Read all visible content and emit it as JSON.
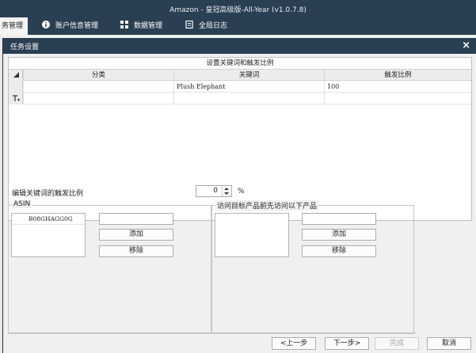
{
  "app": {
    "title": "Amazon - 皇冠高级版-All-Year  (v1.0.7.8)",
    "menu": [
      {
        "label": "务管理",
        "icon": "",
        "active": true
      },
      {
        "label": "账户信息管理",
        "icon": "info-icon",
        "active": false
      },
      {
        "label": "数据管理",
        "icon": "grid-icon",
        "active": false
      },
      {
        "label": "全局日志",
        "icon": "document-icon",
        "active": false
      }
    ]
  },
  "dialog": {
    "title": "任务设置",
    "close_glyph": "×",
    "grid": {
      "caption": "设置关键词和触发比例",
      "columns": [
        "分类",
        "关键词",
        "触发比例"
      ],
      "rows": [
        {
          "category": "",
          "keyword": "Plush Elephant",
          "ratio": "100"
        },
        {
          "category": "",
          "keyword": "",
          "ratio": ""
        }
      ]
    },
    "trigger": {
      "label": "编辑关键词的触发比例",
      "value": "0",
      "unit": "%"
    },
    "asin_group": {
      "legend": "ASIN",
      "items": [
        "B08GHAGG0G"
      ],
      "input_value": "",
      "add_label": "添加",
      "remove_label": "移除"
    },
    "visit_group": {
      "legend": "访问目标产品前先访问以下产品",
      "items": [],
      "input_value": "",
      "add_label": "添加",
      "remove_label": "移除"
    },
    "footer": {
      "prev_label": "<上一步",
      "next_label": "下一步>",
      "finish_label": "完成",
      "cancel_label": "取消"
    }
  }
}
